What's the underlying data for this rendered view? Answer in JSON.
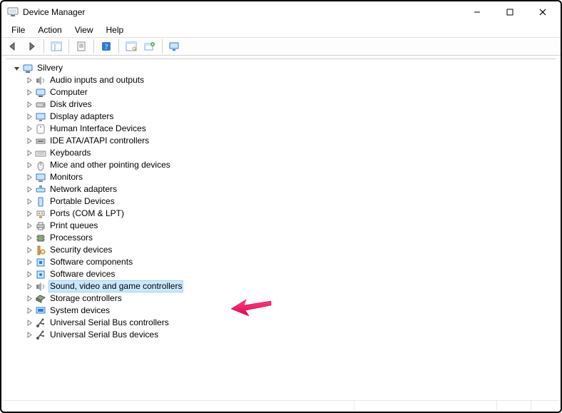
{
  "window": {
    "title": "Device Manager"
  },
  "menu": {
    "file": "File",
    "action": "Action",
    "view": "View",
    "help": "Help"
  },
  "tree": {
    "root": "Silvery",
    "items": [
      "Audio inputs and outputs",
      "Computer",
      "Disk drives",
      "Display adapters",
      "Human Interface Devices",
      "IDE ATA/ATAPI controllers",
      "Keyboards",
      "Mice and other pointing devices",
      "Monitors",
      "Network adapters",
      "Portable Devices",
      "Ports (COM & LPT)",
      "Print queues",
      "Processors",
      "Security devices",
      "Software components",
      "Software devices",
      "Sound, video and game controllers",
      "Storage controllers",
      "System devices",
      "Universal Serial Bus controllers",
      "Universal Serial Bus devices"
    ],
    "selected_index": 17
  },
  "icons": {
    "root": "computer-icon",
    "items": [
      "speaker-icon",
      "computer-icon",
      "drive-icon",
      "display-icon",
      "hid-icon",
      "ide-icon",
      "keyboard-icon",
      "mouse-icon",
      "monitor-icon",
      "network-icon",
      "portable-icon",
      "ports-icon",
      "printer-icon",
      "processor-icon",
      "security-icon",
      "software-component-icon",
      "software-icon",
      "speaker-icon",
      "storage-icon",
      "system-icon",
      "usb-icon",
      "usb-icon"
    ]
  }
}
